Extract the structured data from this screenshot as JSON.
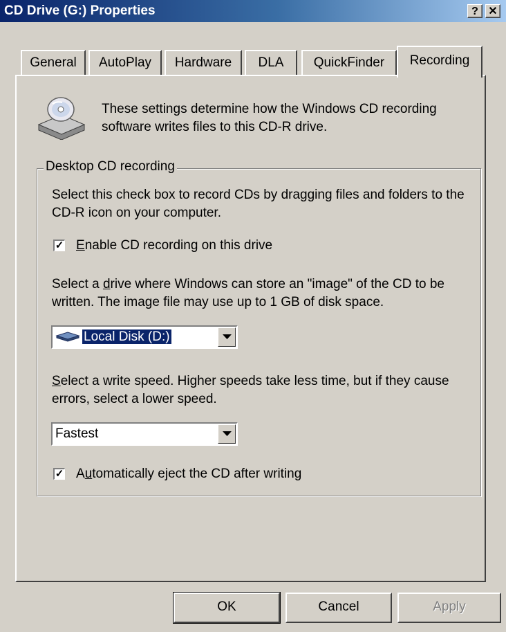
{
  "window": {
    "title": "CD Drive (G:) Properties",
    "help_glyph": "?",
    "close_glyph": "✕"
  },
  "tabs": [
    {
      "label": "General"
    },
    {
      "label": "AutoPlay"
    },
    {
      "label": "Hardware"
    },
    {
      "label": "DLA"
    },
    {
      "label": "QuickFinder"
    },
    {
      "label": "Recording",
      "active": true
    }
  ],
  "intro": {
    "icon": "cd-drive-icon",
    "text": "These settings determine how the Windows CD recording software writes files to this CD-R drive."
  },
  "desktop_recording": {
    "group_label": "Desktop CD recording",
    "description": "Select this check box to record CDs by dragging files and folders to the CD-R icon on your computer.",
    "enable_checkbox": {
      "checked": true,
      "label_prefix": "",
      "label_accel": "E",
      "label_rest": "nable CD recording on this drive"
    },
    "drive_description_prefix": "Select a ",
    "drive_description_accel": "d",
    "drive_description_rest": "rive where Windows can store an \"image\" of the CD to be written. The image file may use up to 1 GB of disk space.",
    "drive_select": {
      "icon": "local-disk-icon",
      "value": "Local Disk (D:)"
    },
    "speed_description_accel": "S",
    "speed_description_rest": "elect a write speed.  Higher speeds take less time, but if they cause errors, select a lower speed.",
    "speed_select": {
      "value": "Fastest"
    },
    "eject_checkbox": {
      "checked": true,
      "label_prefix": "A",
      "label_accel": "u",
      "label_rest": "tomatically eject the CD after writing"
    }
  },
  "buttons": {
    "ok": "OK",
    "cancel": "Cancel",
    "apply": "Apply"
  },
  "colors": {
    "face": "#d4d0c8",
    "title_gradient_start": "#0a246a",
    "title_gradient_end": "#a6caf0",
    "selection": "#0a246a"
  }
}
